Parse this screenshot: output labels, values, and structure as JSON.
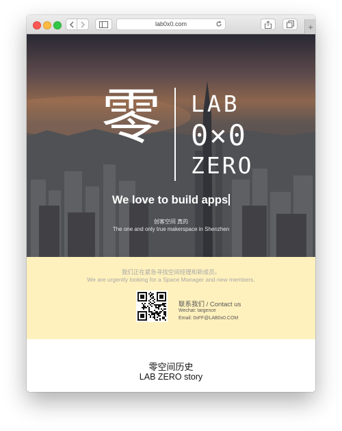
{
  "browser": {
    "url": "lab0x0.com",
    "new_tab_symbol": "+",
    "icons": [
      "back-chevron-icon",
      "forward-chevron-icon",
      "sidebar-icon",
      "reload-icon",
      "share-icon",
      "tabs-icon"
    ]
  },
  "hero": {
    "logo_char": "零",
    "logo_line1": "LAB",
    "logo_line2": "0×0",
    "logo_line3": "ZERO",
    "tagline": "We love to build apps",
    "subtitle_cn": "创客空间 真的",
    "subtitle_en": "The one and only true makerspace in Shenzhen"
  },
  "notice": {
    "text_cn": "我们正在紧急寻找空间经理和新成员。",
    "text_en": "We are urgently looking for a Space Manager and new members.",
    "contact_title": "联系我们 / Contact us",
    "wechat": "Wechat: targence",
    "email": "Email: 0xFF@LAB0x0.COM",
    "background_color": "#fff1bd"
  },
  "story": {
    "title_cn": "零空间历史",
    "title_en": "LAB ZERO story"
  }
}
